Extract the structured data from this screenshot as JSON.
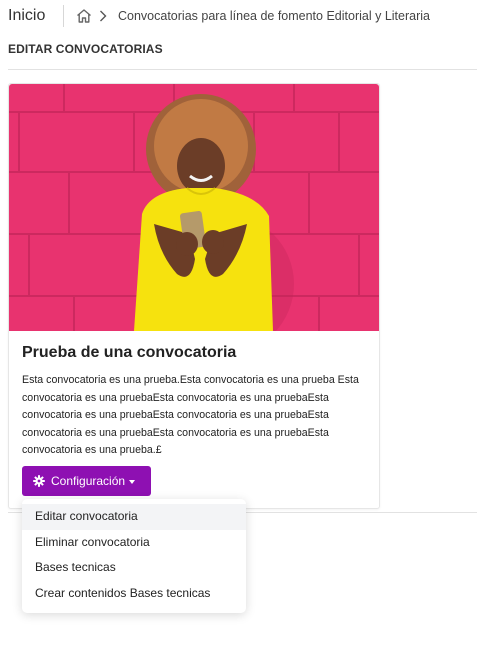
{
  "header": {
    "home_title": "Inicio",
    "breadcrumb": "Convocatorias para línea de fomento Editorial y Literaria"
  },
  "page": {
    "section_title": "EDITAR CONVOCATORIAS"
  },
  "card": {
    "image_alt": "Persona con camiseta amarilla mirando su teléfono frente a una pared rosa",
    "title": "Prueba de una convocatoria",
    "description": "Esta convocatoria es una prueba.Esta convocatoria es una prueba Esta convocatoria es una pruebaEsta convocatoria es una pruebaEsta convocatoria es una pruebaEsta convocatoria es una pruebaEsta convocatoria es una pruebaEsta convocatoria es una pruebaEsta convocatoria es una prueba.£",
    "config_button": "Configuración"
  },
  "dropdown": {
    "items": [
      {
        "label": "Editar convocatoria"
      },
      {
        "label": "Eliminar convocatoria"
      },
      {
        "label": "Bases tecnicas"
      },
      {
        "label": "Crear contenidos Bases tecnicas"
      }
    ]
  },
  "colors": {
    "accent": "#8e10b2",
    "wall": "#e8336f",
    "shirt": "#f6e20e"
  },
  "icons": {
    "home": "home-icon",
    "breadcrumb_separator": "chevron-right-icon",
    "button": "gear-icon",
    "dropdown": "caret-down-icon"
  }
}
